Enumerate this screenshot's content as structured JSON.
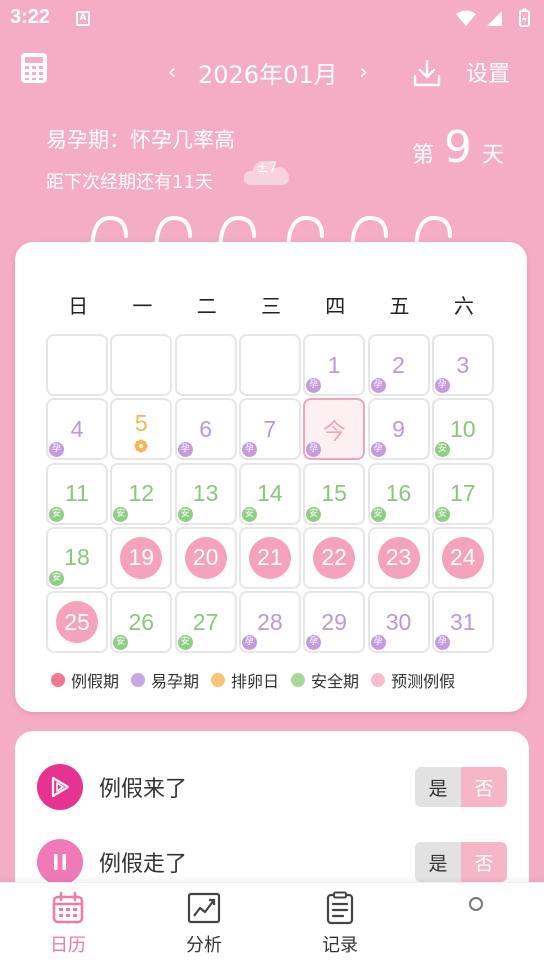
{
  "status_bar": {
    "time": "3:22",
    "sim": "A"
  },
  "header": {
    "month": "2026年01月",
    "prev": "‹",
    "next": "›",
    "settings": "设置"
  },
  "info": {
    "phase": "易孕期：怀孕几率高",
    "countdown": "距下次经期还有11天",
    "badge": "±7",
    "day_prefix": "第",
    "day_number": "9",
    "day_suffix": "天"
  },
  "calendar": {
    "weekdays": [
      "日",
      "一",
      "二",
      "三",
      "四",
      "五",
      "六"
    ],
    "tag_fertile": "孕",
    "tag_safe": "安",
    "days": [
      {
        "label": "",
        "type": "empty"
      },
      {
        "label": "",
        "type": "empty"
      },
      {
        "label": "",
        "type": "empty"
      },
      {
        "label": "",
        "type": "empty"
      },
      {
        "label": "1",
        "type": "fert"
      },
      {
        "label": "2",
        "type": "fert"
      },
      {
        "label": "3",
        "type": "fert"
      },
      {
        "label": "4",
        "type": "fert"
      },
      {
        "label": "5",
        "type": "ovu"
      },
      {
        "label": "6",
        "type": "fert"
      },
      {
        "label": "7",
        "type": "fert"
      },
      {
        "label": "今",
        "type": "today"
      },
      {
        "label": "9",
        "type": "fert"
      },
      {
        "label": "10",
        "type": "safe"
      },
      {
        "label": "11",
        "type": "safe"
      },
      {
        "label": "12",
        "type": "safe"
      },
      {
        "label": "13",
        "type": "safe"
      },
      {
        "label": "14",
        "type": "safe"
      },
      {
        "label": "15",
        "type": "safe"
      },
      {
        "label": "16",
        "type": "safe"
      },
      {
        "label": "17",
        "type": "safe"
      },
      {
        "label": "18",
        "type": "safe"
      },
      {
        "label": "19",
        "type": "pred"
      },
      {
        "label": "20",
        "type": "pred"
      },
      {
        "label": "21",
        "type": "pred"
      },
      {
        "label": "22",
        "type": "pred"
      },
      {
        "label": "23",
        "type": "pred"
      },
      {
        "label": "24",
        "type": "pred"
      },
      {
        "label": "25",
        "type": "pred"
      },
      {
        "label": "26",
        "type": "safe"
      },
      {
        "label": "27",
        "type": "safe"
      },
      {
        "label": "28",
        "type": "fert"
      },
      {
        "label": "29",
        "type": "fert"
      },
      {
        "label": "30",
        "type": "fert"
      },
      {
        "label": "31",
        "type": "fert"
      }
    ],
    "legend": [
      {
        "label": "例假期",
        "color": "#f07a8c"
      },
      {
        "label": "易孕期",
        "color": "#c9a6e6"
      },
      {
        "label": "排卵日",
        "color": "#f6c476"
      },
      {
        "label": "安全期",
        "color": "#a8d89a"
      },
      {
        "label": "预测例假",
        "color": "#f8c0cd"
      }
    ]
  },
  "records": [
    {
      "label": "例假来了",
      "yes": "是",
      "no": "否"
    },
    {
      "label": "例假走了",
      "yes": "是",
      "no": "否"
    }
  ],
  "nav": {
    "calendar": "日历",
    "analysis": "分析",
    "records": "记录"
  },
  "colors": {
    "background": "#f5adc6",
    "accent": "#f07aa0",
    "fertile": "#b99ad6",
    "safe": "#8bc67c",
    "ovulation": "#f2b85a"
  }
}
